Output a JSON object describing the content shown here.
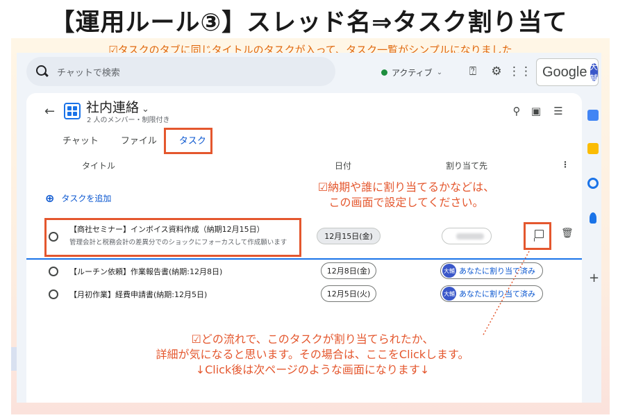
{
  "heading": "【運用ルール③】スレッド名⇒タスク割り当て",
  "subnote": "☑タスクのタブに同じタイトルのタスクが入って、タスク一覧がシンプルになりました",
  "topbar": {
    "search_placeholder": "チャットで検索",
    "status_label": "アクティブ",
    "google_label": "Google",
    "avatar_text": "大輔"
  },
  "space": {
    "name": "社内連絡",
    "meta": "2 人のメンバー・制限付き"
  },
  "tabs": [
    {
      "label": "チャット",
      "active": false
    },
    {
      "label": "ファイル",
      "active": false
    },
    {
      "label": "タスク",
      "active": true
    }
  ],
  "columns": {
    "title": "タイトル",
    "date": "日付",
    "assignee": "割り当て先"
  },
  "add_task_label": "タスクを追加",
  "tasks": [
    {
      "title": "【商社セミナー】インボイス資料作成（納期12月15日）",
      "description": "管理会計と税務会計の差異分でのショックにフォーカスして作成願います",
      "date": "12月15日(金)",
      "assignee": ""
    },
    {
      "title": "【ルーチン依頼】作業報告書(納期:12月8日)",
      "description": "",
      "date": "12月8日(金)",
      "assignee": "あなたに割り当て済み",
      "assignee_avatar": "大輔"
    },
    {
      "title": "【月初作業】経費申請書(納期:12月5日)",
      "description": "",
      "date": "12月5日(火)",
      "assignee": "あなたに割り当て済み",
      "assignee_avatar": "大輔"
    }
  ],
  "annotations": {
    "note1_line1": "☑納期や誰に割り当てるかなどは、",
    "note1_line2": "この画面で設定してください。",
    "note2_line1": "☑どの流れで、このタスクが割り当てられたか、",
    "note2_line2": "詳細が気になると思います。その場合は、ここをClickします。",
    "note2_line3": "↓Click後は次ページのような画面になります↓"
  },
  "colors": {
    "accent": "#0b57d0",
    "highlight": "#e4572e",
    "subnote": "#e06a10"
  }
}
